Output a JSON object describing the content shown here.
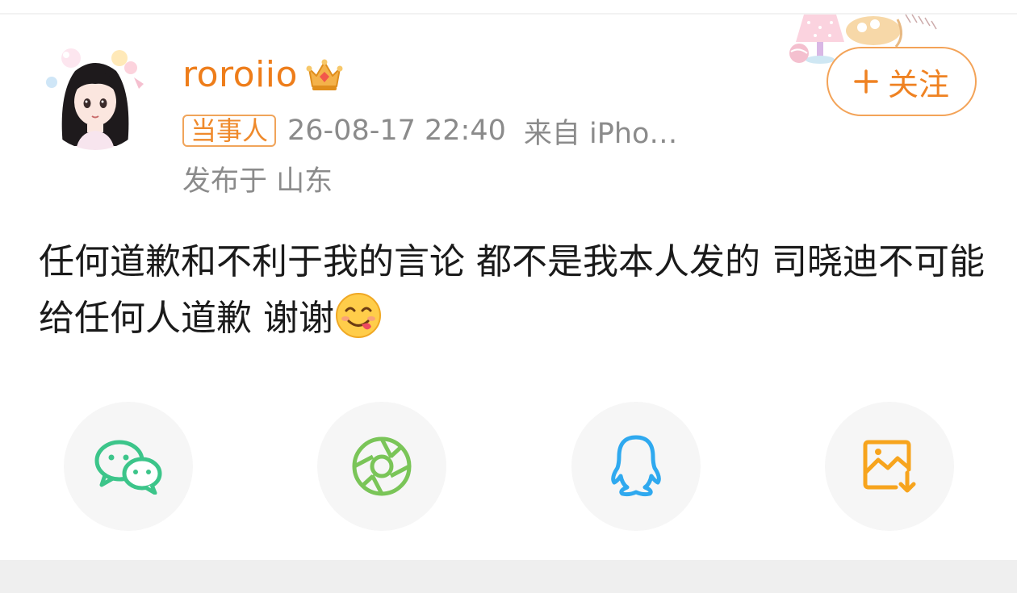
{
  "post": {
    "username": "roroiio",
    "badge": "当事人",
    "time": "26-08-17 22:40",
    "source": "来自 iPho…",
    "location": "发布于 山东",
    "follow_label": "关注",
    "text": "任何道歉和不利于我的言论 都不是我本人发的 司晓迪不可能给任何人道歉 谢谢",
    "emoji": "yum-face-icon"
  },
  "share": [
    {
      "name": "wechat",
      "icon": "wechat-icon",
      "color": "#3cc58a"
    },
    {
      "name": "moments",
      "icon": "moments-shutter-icon",
      "color": "#7ac558"
    },
    {
      "name": "qq",
      "icon": "qq-penguin-icon",
      "color": "#2fa9ef"
    },
    {
      "name": "save-image",
      "icon": "save-image-icon",
      "color": "#f7a41d"
    }
  ],
  "colors": {
    "accent": "#ee7d1a",
    "meta_text": "#8b8b8b",
    "body_text": "#1a1a1a"
  }
}
